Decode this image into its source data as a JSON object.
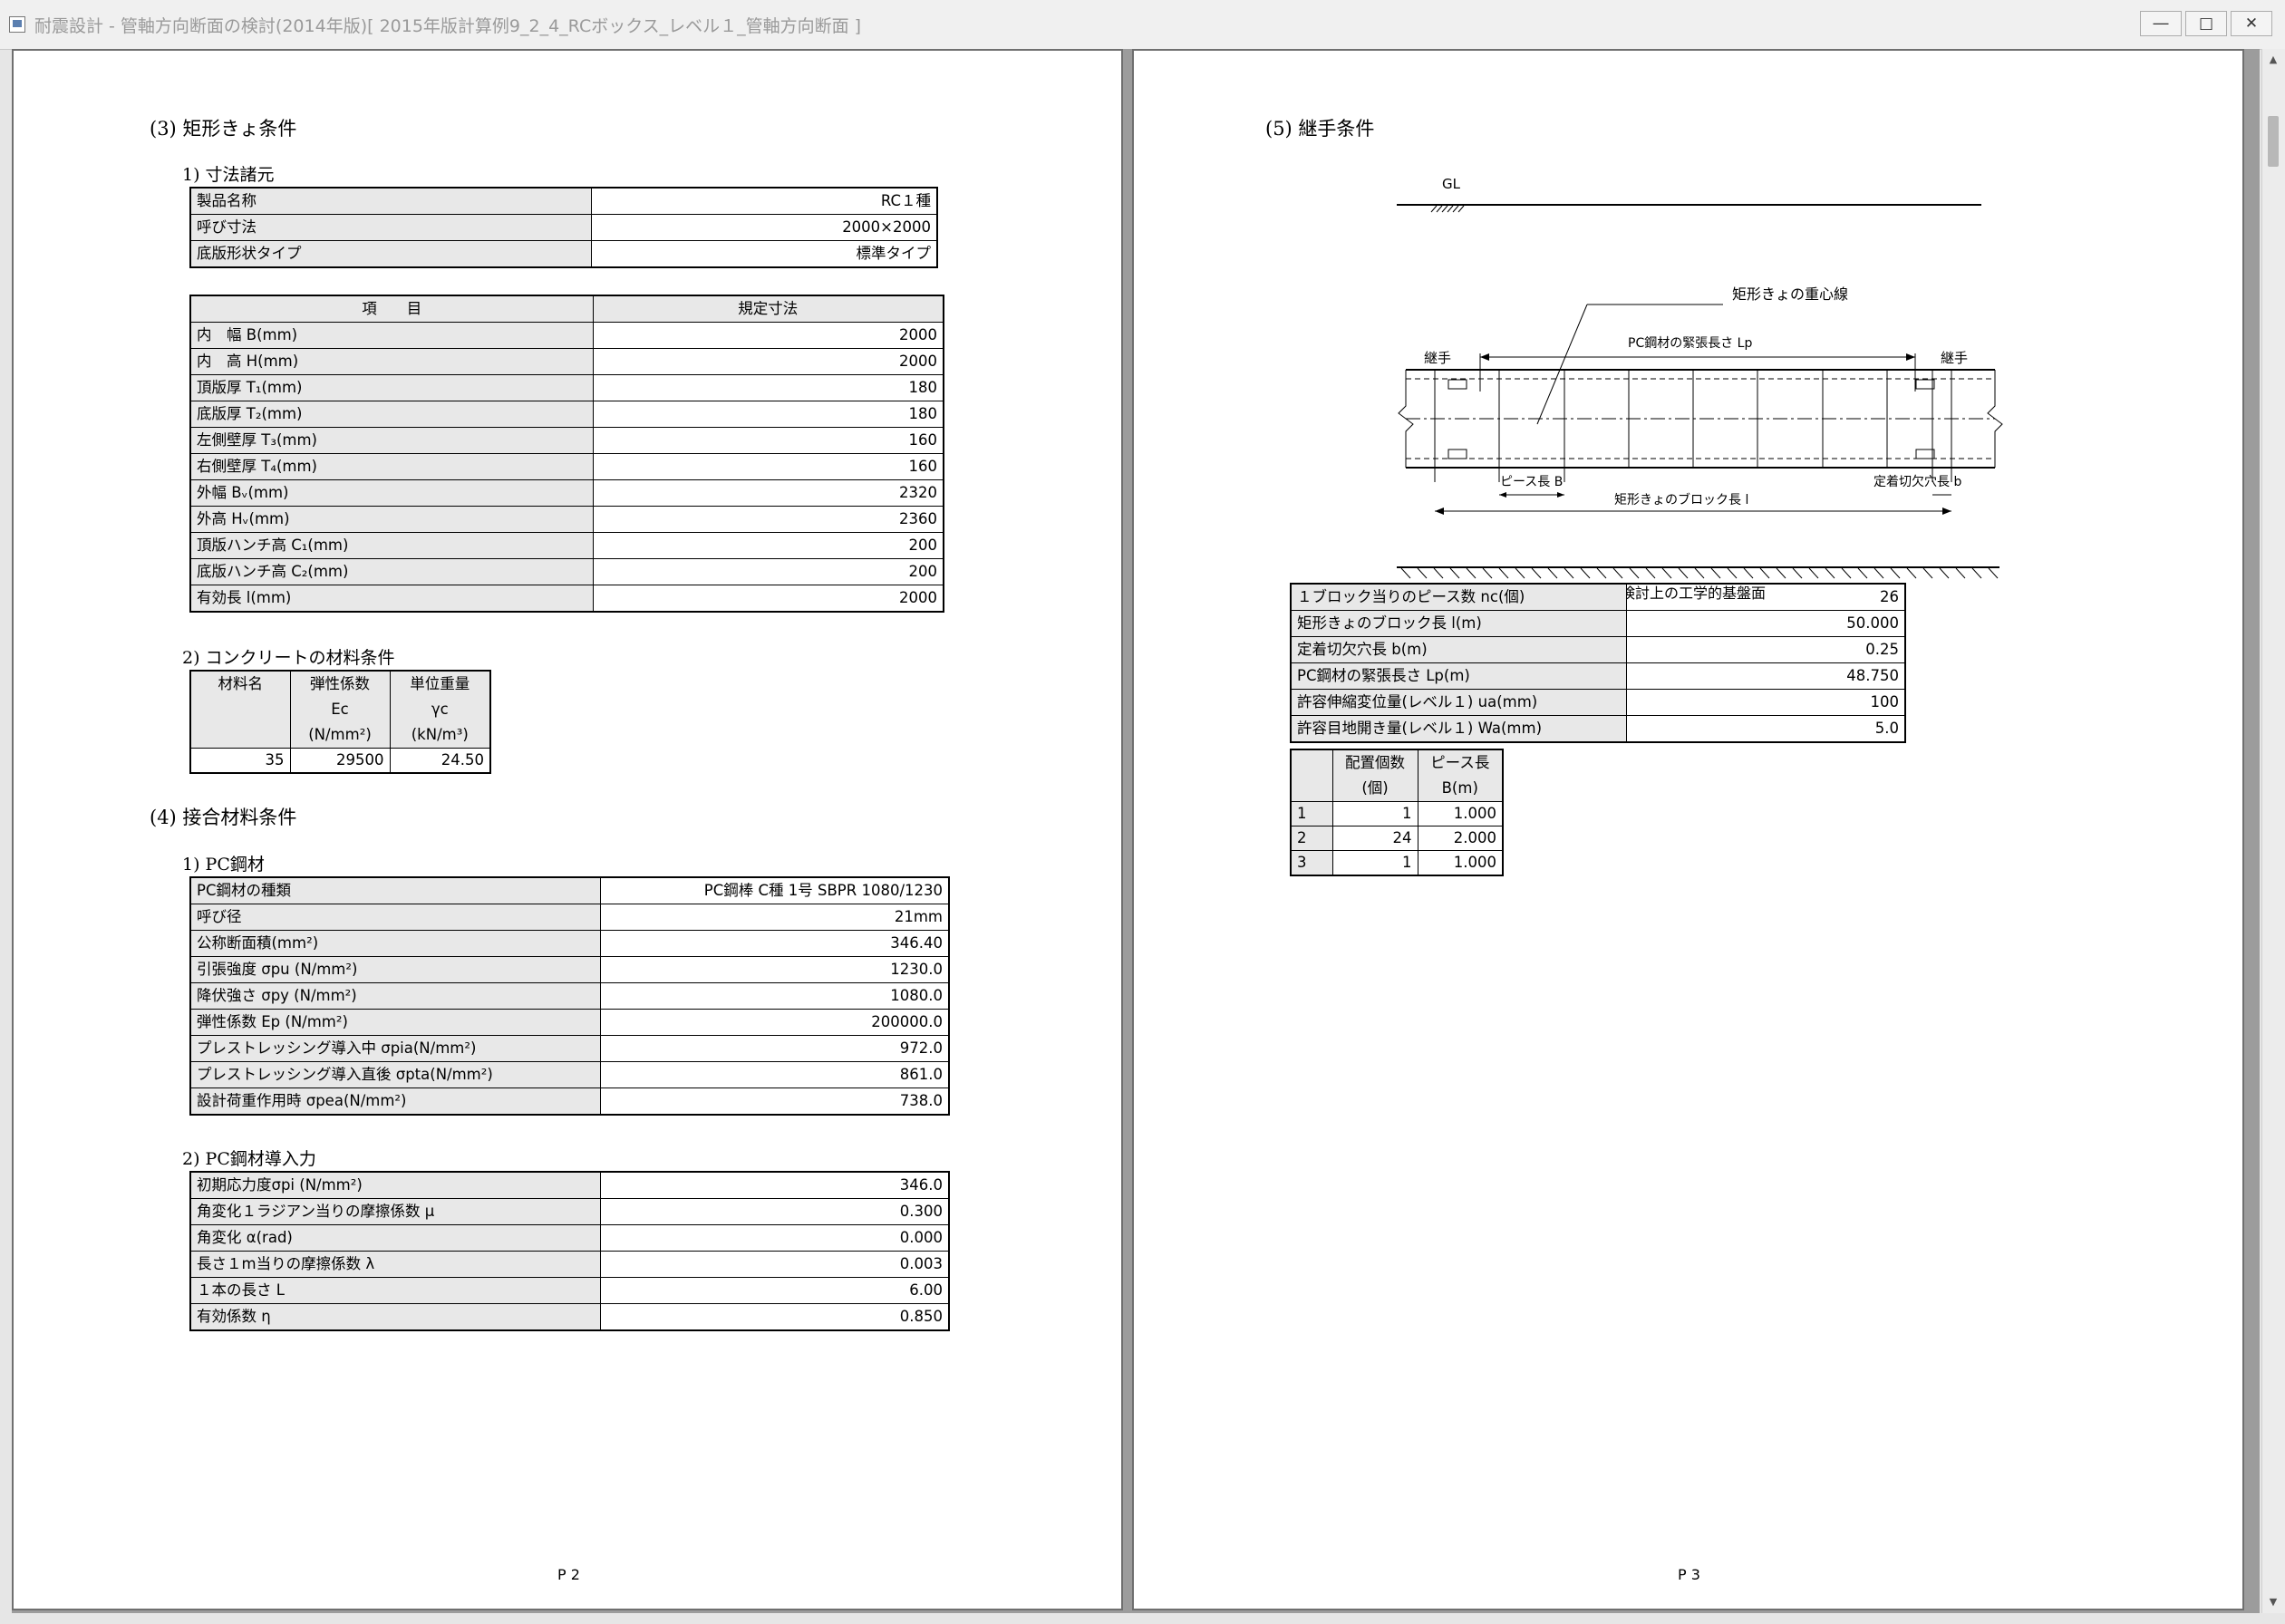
{
  "window": {
    "title": "耐震設計 - 管軸方向断面の検討(2014年版)[ 2015年版計算例9_2_4_RCボックス_レベル１_管軸方向断面 ]",
    "minimize": "―",
    "maximize": "□",
    "close": "✕"
  },
  "left_page": {
    "section3_title": "(3)  矩形きょ条件",
    "dims_title": "1)  寸法諸元",
    "product_rows": [
      {
        "label": "製品名称",
        "value": "RC１種"
      },
      {
        "label": "呼び寸法",
        "value": "2000×2000"
      },
      {
        "label": "底版形状タイプ",
        "value": "標準タイプ"
      }
    ],
    "dims_header": {
      "item": "項　　目",
      "value": "規定寸法"
    },
    "dims_rows": [
      {
        "label": "内　幅 B(mm)",
        "value": "2000"
      },
      {
        "label": "内　高 H(mm)",
        "value": "2000"
      },
      {
        "label": "頂版厚 T₁(mm)",
        "value": "180"
      },
      {
        "label": "底版厚 T₂(mm)",
        "value": "180"
      },
      {
        "label": "左側壁厚 T₃(mm)",
        "value": "160"
      },
      {
        "label": "右側壁厚 T₄(mm)",
        "value": "160"
      },
      {
        "label": "外幅 Bᵥ(mm)",
        "value": "2320"
      },
      {
        "label": "外高 Hᵥ(mm)",
        "value": "2360"
      },
      {
        "label": "頂版ハンチ高 C₁(mm)",
        "value": "200"
      },
      {
        "label": "底版ハンチ高 C₂(mm)",
        "value": "200"
      },
      {
        "label": "有効長 l(mm)",
        "value": "2000"
      }
    ],
    "concrete_title": "2)  コンクリートの材料条件",
    "concrete_header": {
      "name": "材料名",
      "elastic": "弾性係数",
      "elastic_sym": "Ec",
      "elastic_unit": "(N/mm²)",
      "weight": "単位重量",
      "weight_sym": "γc",
      "weight_unit": "(kN/m³)"
    },
    "concrete_row": {
      "name": "35",
      "elastic": "29500",
      "weight": "24.50"
    },
    "section4_title": "(4)  接合材料条件",
    "pc_title": "1)  PC鋼材",
    "pc_rows": [
      {
        "label": "PC鋼材の種類",
        "value": "PC鋼棒 C種 1号 SBPR 1080/1230"
      },
      {
        "label": "呼び径",
        "value": "21mm"
      },
      {
        "label": "公称断面積(mm²)",
        "value": "346.40"
      },
      {
        "label": "引張強度 σpu (N/mm²)",
        "value": "1230.0"
      },
      {
        "label": "降伏強さ σpy (N/mm²)",
        "value": "1080.0"
      },
      {
        "label": "弾性係数 Ep (N/mm²)",
        "value": "200000.0"
      },
      {
        "label": "プレストレッシング導入中 σpia(N/mm²)",
        "value": "972.0"
      },
      {
        "label": "プレストレッシング導入直後 σpta(N/mm²)",
        "value": "861.0"
      },
      {
        "label": "設計荷重作用時 σpea(N/mm²)",
        "value": "738.0"
      }
    ],
    "pcforce_title": "2)  PC鋼材導入力",
    "pcforce_rows": [
      {
        "label": "初期応力度σpi (N/mm²)",
        "value": "346.0"
      },
      {
        "label": "角変化１ラジアン当りの摩擦係数 μ",
        "value": "0.300"
      },
      {
        "label": "角変化 α(rad)",
        "value": "0.000"
      },
      {
        "label": "長さ１m当りの摩擦係数 λ",
        "value": "0.003"
      },
      {
        "label": "１本の長さ L",
        "value": "6.00"
      },
      {
        "label": "有効係数 η",
        "value": "0.850"
      }
    ],
    "page_number": "P 2"
  },
  "right_page": {
    "section5_title": "(5)  継手条件",
    "diagram": {
      "gl": "GL",
      "centroid": "矩形きょの重心線",
      "tension_length": "PC鋼材の緊張長さ Lp",
      "joint_left": "継手",
      "joint_right": "継手",
      "piece_length": "ピース長 B",
      "notch_length": "定着切欠穴長 b",
      "block_length": "矩形きょのブロック長 l",
      "base": "耐震検討上の工学的基盤面"
    },
    "joint_rows": [
      {
        "label": "１ブロック当りのピース数 nc(個)",
        "value": "26"
      },
      {
        "label": "矩形きょのブロック長 l(m)",
        "value": "50.000"
      },
      {
        "label": "定着切欠穴長 b(m)",
        "value": "0.25"
      },
      {
        "label": "PC鋼材の緊張長さ Lp(m)",
        "value": "48.750"
      },
      {
        "label": "許容伸縮変位量(レベル１) ua(mm)",
        "value": "100"
      },
      {
        "label": "許容目地開き量(レベル１) Wa(mm)",
        "value": "5.0"
      }
    ],
    "piece_header": {
      "count": "配置個数",
      "count_unit": "(個)",
      "length": "ピース長",
      "length_unit": "B(m)"
    },
    "piece_rows": [
      {
        "no": "1",
        "count": "1",
        "length": "1.000"
      },
      {
        "no": "2",
        "count": "24",
        "length": "2.000"
      },
      {
        "no": "3",
        "count": "1",
        "length": "1.000"
      }
    ],
    "page_number": "P 3"
  }
}
